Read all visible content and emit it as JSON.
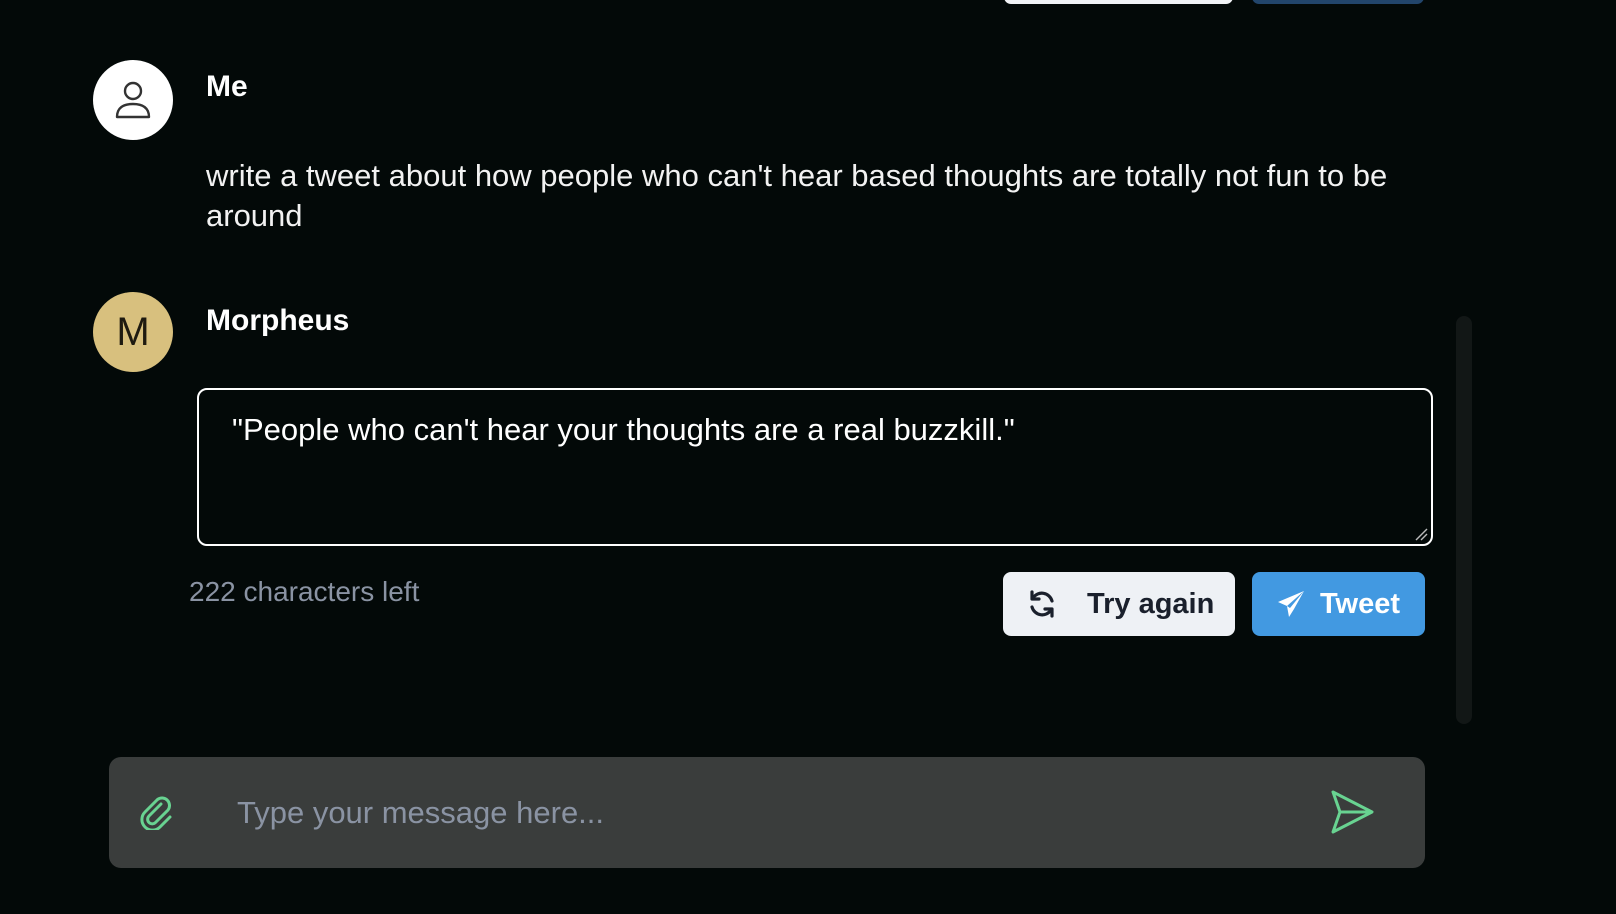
{
  "conversation": {
    "messages": [
      {
        "author": "Me",
        "avatar_icon": "user-icon",
        "text": "write a tweet about how people who can't hear based thoughts are totally not fun to be around"
      },
      {
        "author": "Morpheus",
        "avatar_initial": "M",
        "avatar_color": "#d8c07e"
      }
    ]
  },
  "tweet_draft": {
    "text": "\"People who can't hear your thoughts are a real buzzkill.\"",
    "characters_left": "222 characters left",
    "try_again_label": "Try again",
    "try_again_icon": "refresh-icon",
    "tweet_label": "Tweet",
    "tweet_icon": "paper-plane-icon",
    "tweet_button_color": "#4299e1"
  },
  "composer": {
    "placeholder": "Type your message here...",
    "attach_icon": "paperclip-icon",
    "send_icon": "send-icon",
    "icon_color": "#68d391"
  }
}
